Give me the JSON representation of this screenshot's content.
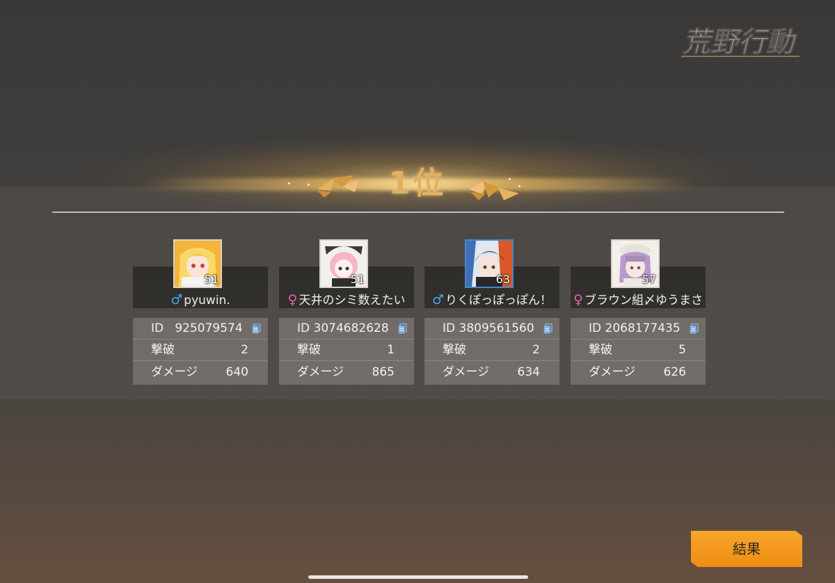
{
  "app": {
    "logo_text": "荒野行動"
  },
  "header": {
    "rank_title": "1位"
  },
  "labels": {
    "id": "ID",
    "kills": "撃破",
    "damage": "ダメージ"
  },
  "players": [
    {
      "gender": "♂",
      "gender_type": "male",
      "name": "pyuwin.",
      "level": "51",
      "id": "925079574",
      "kills": "2",
      "damage": "640",
      "avatar_icon": "blonde-girl-avatar-icon"
    },
    {
      "gender": "♀",
      "gender_type": "female",
      "name": "天井のシミ数えたい",
      "level": "51",
      "id": "3074682628",
      "kills": "1",
      "damage": "865",
      "avatar_icon": "pink-hair-girl-avatar-icon"
    },
    {
      "gender": "♂",
      "gender_type": "male",
      "name": "りくぽっぽっぽん！",
      "level": "63",
      "id": "3809561560",
      "kills": "2",
      "damage": "634",
      "avatar_icon": "dark-hair-boy-avatar-icon"
    },
    {
      "gender": "♀",
      "gender_type": "female",
      "name": "ブラウン組〆ゆうまさ",
      "level": "57",
      "id": "2068177435",
      "kills": "5",
      "damage": "626",
      "avatar_icon": "purple-hair-girl-avatar-icon"
    }
  ],
  "footer": {
    "result_button": "結果"
  },
  "colors": {
    "accent": "#f39a1e",
    "male": "#4aa6e0",
    "female": "#e95fa8",
    "rank_gold": "#e1b063"
  }
}
